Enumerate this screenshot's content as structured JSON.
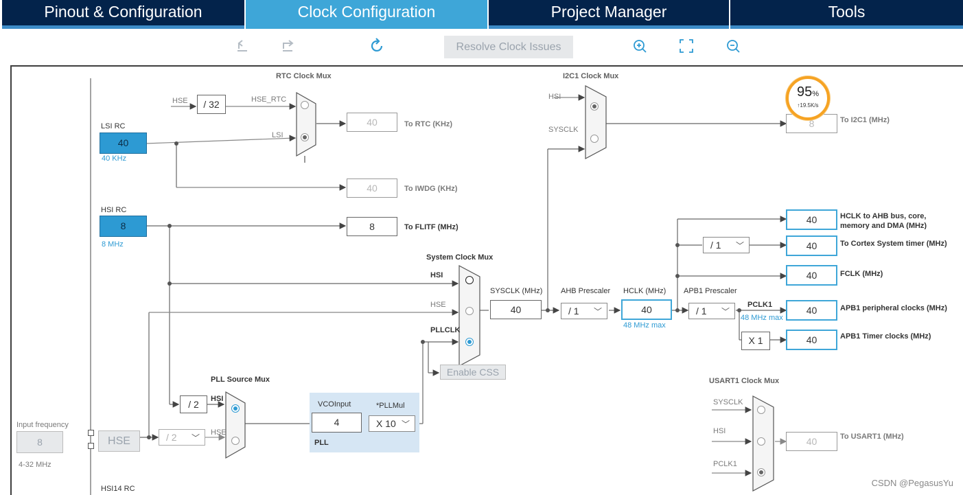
{
  "tabs": [
    "Pinout & Configuration",
    "Clock Configuration",
    "Project Manager",
    "Tools"
  ],
  "toolbar": {
    "resolve_label": "Resolve Clock Issues"
  },
  "gauge": {
    "percent": "95",
    "unit": "%",
    "rate": "↑19.5K/s"
  },
  "rtc_mux": {
    "title": "RTC Clock Mux",
    "in_hse": "HSE",
    "div": "/ 32",
    "hse_rtc": "HSE_RTC",
    "lsi": "LSI",
    "out_value": "40",
    "out_label": "To RTC (KHz)"
  },
  "lsi_rc": {
    "title": "LSI RC",
    "value": "40",
    "freq": "40 KHz"
  },
  "iwdg": {
    "value": "40",
    "label": "To IWDG (KHz)"
  },
  "hsi_rc": {
    "title": "HSI RC",
    "value": "8",
    "freq": "8 MHz"
  },
  "flitf": {
    "value": "8",
    "label": "To FLITF (MHz)"
  },
  "i2c1_mux": {
    "title": "I2C1 Clock Mux",
    "in_hsi": "HSI",
    "in_sysclk": "SYSCLK",
    "out_value": "8",
    "out_label": "To I2C1 (MHz)"
  },
  "sys_mux": {
    "title": "System Clock Mux",
    "hsi": "HSI",
    "hse": "HSE",
    "pllclk": "PLLCLK",
    "enable_css": "Enable CSS"
  },
  "sysclk": {
    "label": "SYSCLK (MHz)",
    "value": "40"
  },
  "ahb": {
    "label": "AHB Prescaler",
    "value": "/ 1"
  },
  "hclk": {
    "label": "HCLK (MHz)",
    "value": "40",
    "max": "48 MHz max"
  },
  "apb1": {
    "label": "APB1 Prescaler",
    "value": "/ 1",
    "pclk1": "PCLK1",
    "max": "48 MHz max",
    "timer_mul": "X 1"
  },
  "cortex_div": "/ 1",
  "outputs": [
    {
      "value": "40",
      "label": "HCLK to AHB bus, core,",
      "label2": "memory and DMA (MHz)"
    },
    {
      "value": "40",
      "label": "To Cortex System timer (MHz)"
    },
    {
      "value": "40",
      "label": "FCLK (MHz)"
    },
    {
      "value": "40",
      "label": "APB1 peripheral clocks (MHz)"
    },
    {
      "value": "40",
      "label": "APB1 Timer clocks (MHz)"
    }
  ],
  "pll_src": {
    "title": "PLL Source Mux",
    "div2": "/ 2",
    "hsi": "HSI",
    "hse": "HSE",
    "hse_div": "/ 2"
  },
  "pll": {
    "vco_label": "VCOInput",
    "vco_value": "4",
    "mul_label": "*PLLMul",
    "mul_value": "X 10",
    "name": "PLL"
  },
  "input_freq": {
    "label": "Input frequency",
    "value": "8",
    "range": "4-32 MHz"
  },
  "hse": {
    "label": "HSE"
  },
  "hsi14": {
    "label": "HSI14 RC"
  },
  "usart1": {
    "title": "USART1 Clock Mux",
    "sysclk": "SYSCLK",
    "hsi": "HSI",
    "pclk1": "PCLK1",
    "out_value": "40",
    "out_label": "To USART1 (MHz)"
  },
  "watermark": "CSDN @PegasusYu",
  "colors": {
    "tab_bg": "#03234b",
    "tab_active": "#3ea6d8",
    "accent": "#2d9ad3",
    "gauge": "#f6a323"
  }
}
